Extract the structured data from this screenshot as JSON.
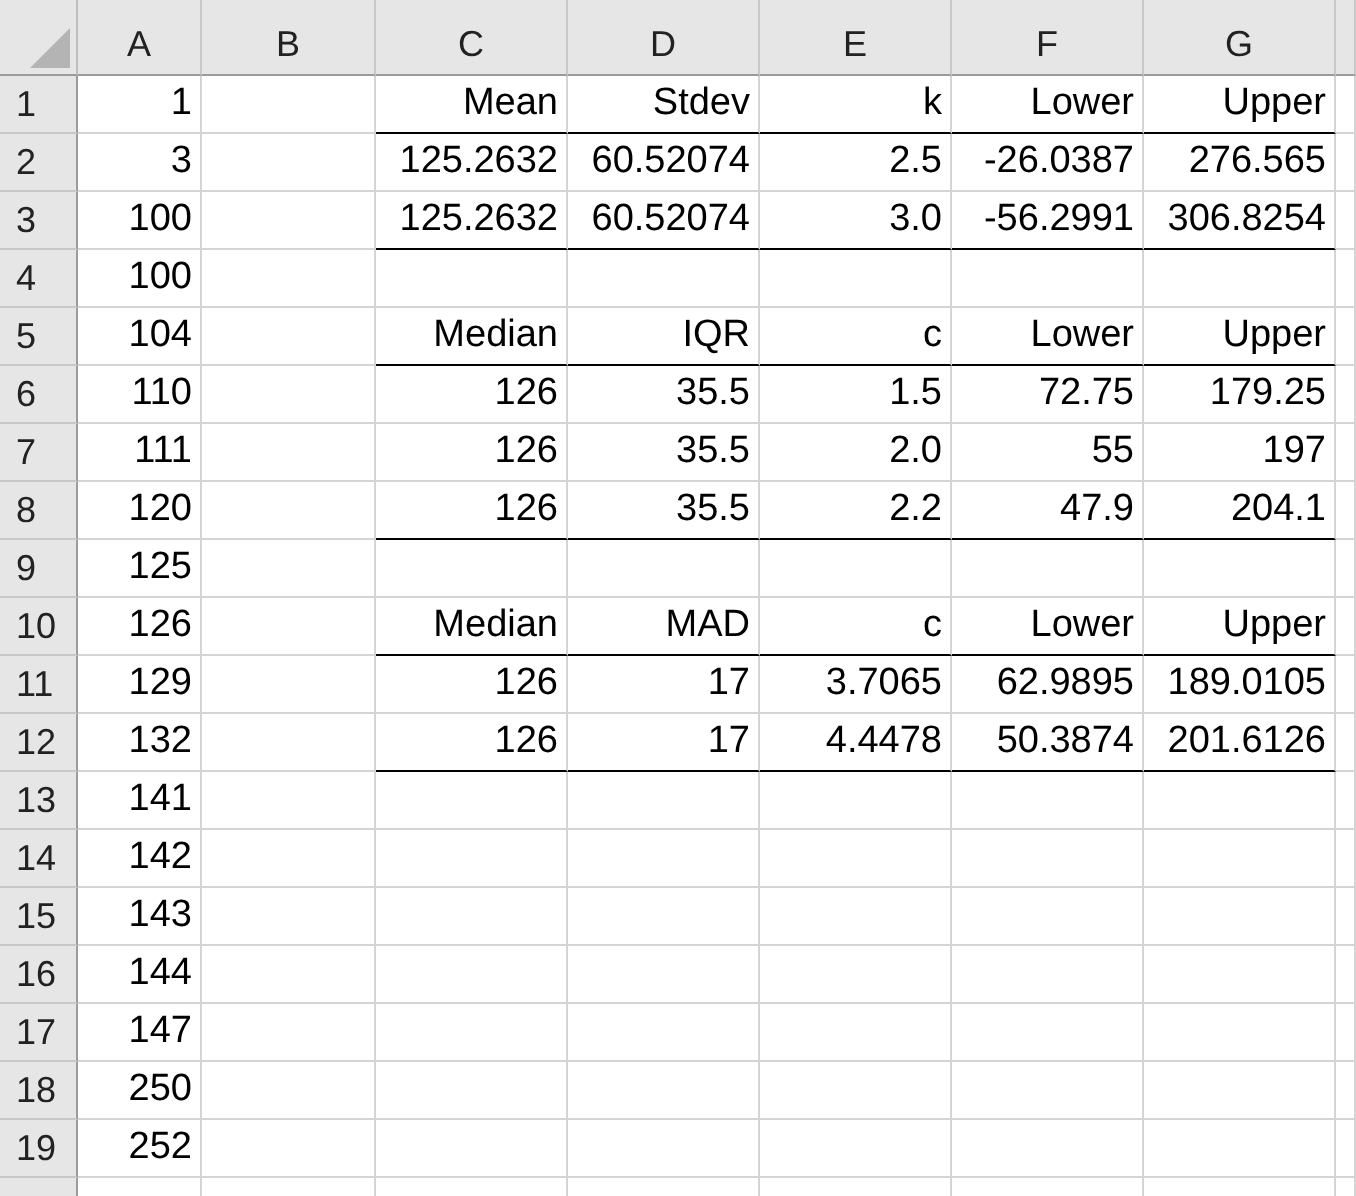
{
  "columns": [
    "A",
    "B",
    "C",
    "D",
    "E",
    "F",
    "G"
  ],
  "rows": [
    {
      "number": "1",
      "underlined": true,
      "cells": {
        "A": "1",
        "C": "Mean",
        "D": "Stdev",
        "E": "k",
        "F": "Lower",
        "G": "Upper"
      }
    },
    {
      "number": "2",
      "underlined": false,
      "cells": {
        "A": "3",
        "C": "125.2632",
        "D": "60.52074",
        "E": "2.5",
        "F": "-26.0387",
        "G": "276.565"
      }
    },
    {
      "number": "3",
      "underlined": true,
      "cells": {
        "A": "100",
        "C": "125.2632",
        "D": "60.52074",
        "E": "3.0",
        "F": "-56.2991",
        "G": "306.8254"
      }
    },
    {
      "number": "4",
      "underlined": false,
      "cells": {
        "A": "100"
      }
    },
    {
      "number": "5",
      "underlined": true,
      "cells": {
        "A": "104",
        "C": "Median",
        "D": "IQR",
        "E": "c",
        "F": "Lower",
        "G": "Upper"
      }
    },
    {
      "number": "6",
      "underlined": false,
      "cells": {
        "A": "110",
        "C": "126",
        "D": "35.5",
        "E": "1.5",
        "F": "72.75",
        "G": "179.25"
      }
    },
    {
      "number": "7",
      "underlined": false,
      "cells": {
        "A": "111",
        "C": "126",
        "D": "35.5",
        "E": "2.0",
        "F": "55",
        "G": "197"
      }
    },
    {
      "number": "8",
      "underlined": true,
      "cells": {
        "A": "120",
        "C": "126",
        "D": "35.5",
        "E": "2.2",
        "F": "47.9",
        "G": "204.1"
      }
    },
    {
      "number": "9",
      "underlined": false,
      "cells": {
        "A": "125"
      }
    },
    {
      "number": "10",
      "underlined": true,
      "cells": {
        "A": "126",
        "C": "Median",
        "D": "MAD",
        "E": "c",
        "F": "Lower",
        "G": "Upper"
      }
    },
    {
      "number": "11",
      "underlined": false,
      "cells": {
        "A": "129",
        "C": "126",
        "D": "17",
        "E": "3.7065",
        "F": "62.9895",
        "G": "189.0105"
      }
    },
    {
      "number": "12",
      "underlined": true,
      "cells": {
        "A": "132",
        "C": "126",
        "D": "17",
        "E": "4.4478",
        "F": "50.3874",
        "G": "201.6126"
      }
    },
    {
      "number": "13",
      "underlined": false,
      "cells": {
        "A": "141"
      }
    },
    {
      "number": "14",
      "underlined": false,
      "cells": {
        "A": "142"
      }
    },
    {
      "number": "15",
      "underlined": false,
      "cells": {
        "A": "143"
      }
    },
    {
      "number": "16",
      "underlined": false,
      "cells": {
        "A": "144"
      }
    },
    {
      "number": "17",
      "underlined": false,
      "cells": {
        "A": "147"
      }
    },
    {
      "number": "18",
      "underlined": false,
      "cells": {
        "A": "250"
      }
    },
    {
      "number": "19",
      "underlined": false,
      "cells": {
        "A": "252"
      }
    }
  ]
}
